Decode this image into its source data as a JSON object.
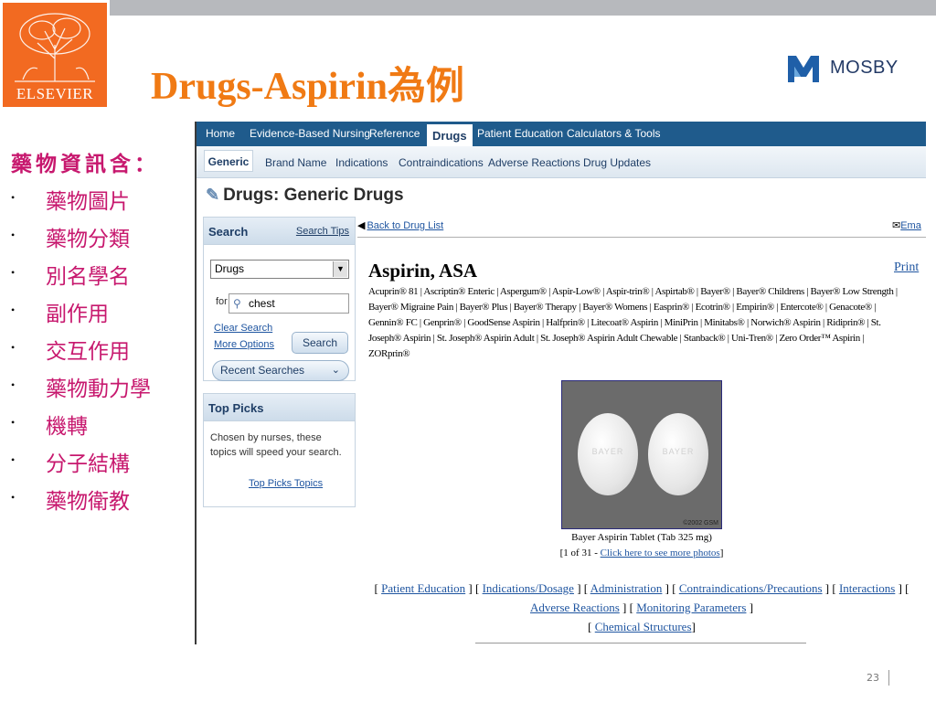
{
  "slide": {
    "title": "Drugs-Aspirin為例",
    "publisher_logo_text": "ELSEVIER",
    "brand_logo_text": "MOSBY",
    "page_number": "23",
    "bullet_heading": "藥物資訊含：",
    "bullets": [
      "藥物圖片",
      "藥物分類",
      "別名學名",
      "副作用",
      "交互作用",
      "藥物動力學",
      "機轉",
      "分子結構",
      "藥物衛教"
    ],
    "colors": {
      "title": "#f07a14",
      "bullets": "#c7186e",
      "logo_bg": "#f26a21"
    }
  },
  "app": {
    "nav_tabs": [
      "Home",
      "Evidence-Based Nursing",
      "Reference",
      "Drugs",
      "Patient Education",
      "Calculators & Tools"
    ],
    "active_nav_tab": "Drugs",
    "sub_tabs": [
      "Generic",
      "Brand Name",
      "Indications",
      "Contraindications",
      "Adverse Reactions",
      "Drug Updates"
    ],
    "active_sub_tab": "Generic",
    "page_heading": "Drugs: Generic Drugs",
    "search_panel": {
      "title": "Search",
      "tips_link": "Search Tips",
      "category_selected": "Drugs",
      "for_label": "for",
      "query_value": "chest",
      "clear_search": "Clear Search",
      "more_options": "More Options",
      "search_button": "Search",
      "recent_searches": "Recent Searches"
    },
    "top_picks": {
      "title": "Top Picks",
      "text": "Chosen by nurses, these topics will speed your search.",
      "link": "Top Picks Topics"
    },
    "back_link": "Back to Drug List",
    "email_link": "Ema",
    "drug": {
      "title": "Aspirin, ASA",
      "print_link": "Print",
      "brands": "Acuprin® 81 | Ascriptin® Enteric | Aspergum® | Aspir-Low® | Aspir-trin® | Aspirtab® | Bayer® | Bayer® Childrens | Bayer® Low Strength | Bayer® Migraine Pain | Bayer® Plus | Bayer® Therapy | Bayer® Womens | Easprin® | Ecotrin® | Empirin® | Entercote® | Genacote® | Gennin® FC | Genprin® | GoodSense Aspirin | Halfprin® | Litecoat® Aspirin | MiniPrin | Minitabs® | Norwich® Aspirin | Ridiprin® | St. Joseph® Aspirin | St. Joseph® Aspirin Adult | St. Joseph® Aspirin Adult Chewable | Stanback® | Uni-Tren® | Zero Order™ Aspirin | ZORprin®",
      "photo_copyright": "©2002 GSM",
      "photo_caption": "Bayer Aspirin Tablet (Tab 325 mg)",
      "photo_count": "1 of 31",
      "photo_more_link": "Click here to see more photos",
      "section_links": [
        "Patient Education",
        "Indications/Dosage",
        "Administration",
        "Contraindications/Precautions",
        "Interactions",
        "Adverse Reactions",
        "Monitoring Parameters",
        "Chemical Structures"
      ]
    }
  }
}
